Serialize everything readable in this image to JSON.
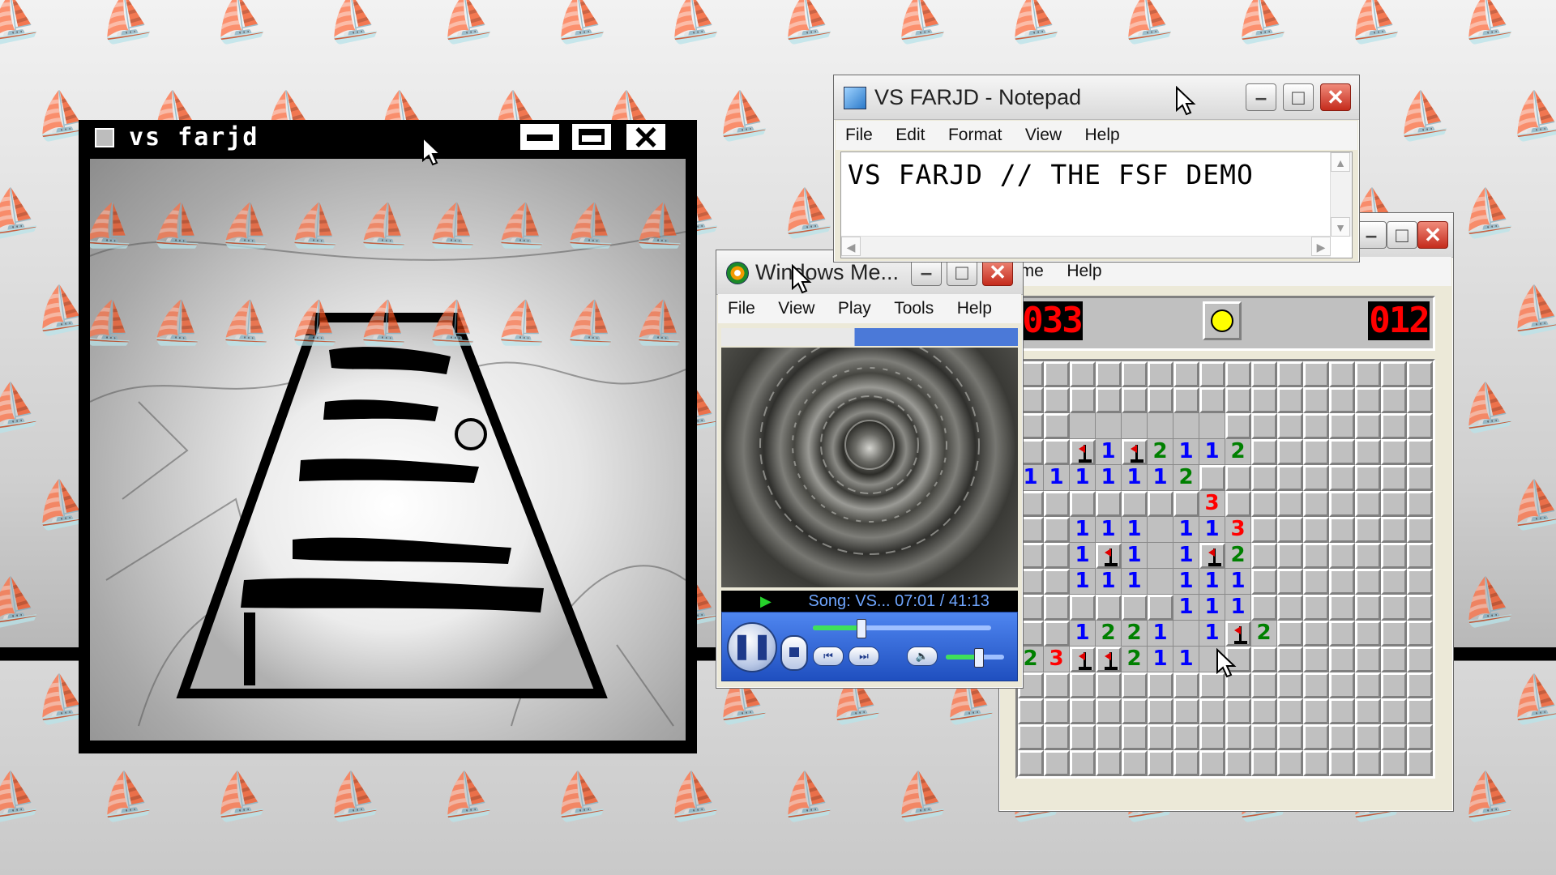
{
  "game_window": {
    "title": "vs farjd",
    "minimize": "–",
    "maximize": "□",
    "close": "✕"
  },
  "notepad": {
    "title": "VS FARJD - Notepad",
    "menu": [
      "File",
      "Edit",
      "Format",
      "View",
      "Help"
    ],
    "content": "VS FARJD // THE FSF DEMO"
  },
  "media_player": {
    "title": "Windows Me...",
    "menu": [
      "File",
      "View",
      "Play",
      "Tools",
      "Help"
    ],
    "status": "Song: VS... 07:01 / 41:13",
    "seek_fraction": 0.27,
    "volume_fraction": 0.55,
    "colors": {
      "accent": "#2a5fd6",
      "status_text": "#6fa6ff"
    }
  },
  "minesweeper": {
    "menu": [
      "ame",
      "Help"
    ],
    "mines_left": "033",
    "time": "012",
    "grid_cols": 16,
    "grid_rows": 16,
    "rows": [
      "cccccccccccccccc",
      "cccccccccccccccc",
      "ccoooooocccccccc",
      "ccf1f2112ccccccc",
      "1111112ccccccccc",
      "ccccccc3cccccccc",
      "cc111.113ccccccc",
      "cc1f1.1f2ccccccc",
      "cc111.111ccccccc",
      "cccccc111ccccccc",
      "cc1221.1f2cccccc",
      "23ff211.cccccccc",
      "cccccccccccccccc",
      "cccccccccccccccc",
      "cccccccccccccccc",
      "cccccccccccccccc"
    ],
    "number_colors": {
      "1": "#0000ff",
      "2": "#008000",
      "3": "#ff0000"
    }
  }
}
